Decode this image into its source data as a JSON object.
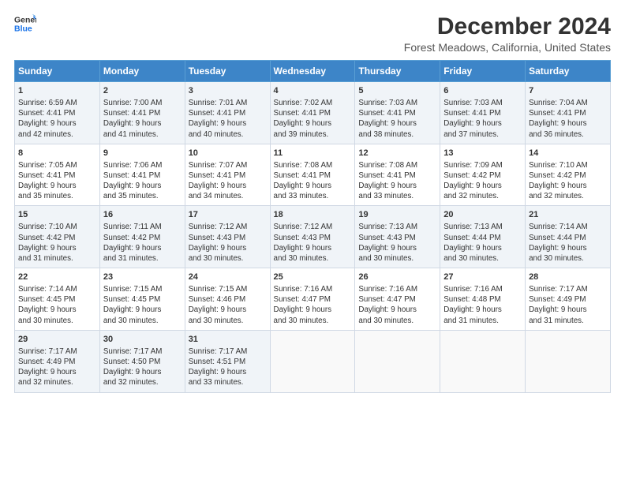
{
  "logo": {
    "line1": "General",
    "line2": "Blue"
  },
  "title": "December 2024",
  "subtitle": "Forest Meadows, California, United States",
  "days_header": [
    "Sunday",
    "Monday",
    "Tuesday",
    "Wednesday",
    "Thursday",
    "Friday",
    "Saturday"
  ],
  "weeks": [
    [
      {
        "num": "1",
        "info": "Sunrise: 6:59 AM\nSunset: 4:41 PM\nDaylight: 9 hours\nand 42 minutes."
      },
      {
        "num": "2",
        "info": "Sunrise: 7:00 AM\nSunset: 4:41 PM\nDaylight: 9 hours\nand 41 minutes."
      },
      {
        "num": "3",
        "info": "Sunrise: 7:01 AM\nSunset: 4:41 PM\nDaylight: 9 hours\nand 40 minutes."
      },
      {
        "num": "4",
        "info": "Sunrise: 7:02 AM\nSunset: 4:41 PM\nDaylight: 9 hours\nand 39 minutes."
      },
      {
        "num": "5",
        "info": "Sunrise: 7:03 AM\nSunset: 4:41 PM\nDaylight: 9 hours\nand 38 minutes."
      },
      {
        "num": "6",
        "info": "Sunrise: 7:03 AM\nSunset: 4:41 PM\nDaylight: 9 hours\nand 37 minutes."
      },
      {
        "num": "7",
        "info": "Sunrise: 7:04 AM\nSunset: 4:41 PM\nDaylight: 9 hours\nand 36 minutes."
      }
    ],
    [
      {
        "num": "8",
        "info": "Sunrise: 7:05 AM\nSunset: 4:41 PM\nDaylight: 9 hours\nand 35 minutes."
      },
      {
        "num": "9",
        "info": "Sunrise: 7:06 AM\nSunset: 4:41 PM\nDaylight: 9 hours\nand 35 minutes."
      },
      {
        "num": "10",
        "info": "Sunrise: 7:07 AM\nSunset: 4:41 PM\nDaylight: 9 hours\nand 34 minutes."
      },
      {
        "num": "11",
        "info": "Sunrise: 7:08 AM\nSunset: 4:41 PM\nDaylight: 9 hours\nand 33 minutes."
      },
      {
        "num": "12",
        "info": "Sunrise: 7:08 AM\nSunset: 4:41 PM\nDaylight: 9 hours\nand 33 minutes."
      },
      {
        "num": "13",
        "info": "Sunrise: 7:09 AM\nSunset: 4:42 PM\nDaylight: 9 hours\nand 32 minutes."
      },
      {
        "num": "14",
        "info": "Sunrise: 7:10 AM\nSunset: 4:42 PM\nDaylight: 9 hours\nand 32 minutes."
      }
    ],
    [
      {
        "num": "15",
        "info": "Sunrise: 7:10 AM\nSunset: 4:42 PM\nDaylight: 9 hours\nand 31 minutes."
      },
      {
        "num": "16",
        "info": "Sunrise: 7:11 AM\nSunset: 4:42 PM\nDaylight: 9 hours\nand 31 minutes."
      },
      {
        "num": "17",
        "info": "Sunrise: 7:12 AM\nSunset: 4:43 PM\nDaylight: 9 hours\nand 30 minutes."
      },
      {
        "num": "18",
        "info": "Sunrise: 7:12 AM\nSunset: 4:43 PM\nDaylight: 9 hours\nand 30 minutes."
      },
      {
        "num": "19",
        "info": "Sunrise: 7:13 AM\nSunset: 4:43 PM\nDaylight: 9 hours\nand 30 minutes."
      },
      {
        "num": "20",
        "info": "Sunrise: 7:13 AM\nSunset: 4:44 PM\nDaylight: 9 hours\nand 30 minutes."
      },
      {
        "num": "21",
        "info": "Sunrise: 7:14 AM\nSunset: 4:44 PM\nDaylight: 9 hours\nand 30 minutes."
      }
    ],
    [
      {
        "num": "22",
        "info": "Sunrise: 7:14 AM\nSunset: 4:45 PM\nDaylight: 9 hours\nand 30 minutes."
      },
      {
        "num": "23",
        "info": "Sunrise: 7:15 AM\nSunset: 4:45 PM\nDaylight: 9 hours\nand 30 minutes."
      },
      {
        "num": "24",
        "info": "Sunrise: 7:15 AM\nSunset: 4:46 PM\nDaylight: 9 hours\nand 30 minutes."
      },
      {
        "num": "25",
        "info": "Sunrise: 7:16 AM\nSunset: 4:47 PM\nDaylight: 9 hours\nand 30 minutes."
      },
      {
        "num": "26",
        "info": "Sunrise: 7:16 AM\nSunset: 4:47 PM\nDaylight: 9 hours\nand 30 minutes."
      },
      {
        "num": "27",
        "info": "Sunrise: 7:16 AM\nSunset: 4:48 PM\nDaylight: 9 hours\nand 31 minutes."
      },
      {
        "num": "28",
        "info": "Sunrise: 7:17 AM\nSunset: 4:49 PM\nDaylight: 9 hours\nand 31 minutes."
      }
    ],
    [
      {
        "num": "29",
        "info": "Sunrise: 7:17 AM\nSunset: 4:49 PM\nDaylight: 9 hours\nand 32 minutes."
      },
      {
        "num": "30",
        "info": "Sunrise: 7:17 AM\nSunset: 4:50 PM\nDaylight: 9 hours\nand 32 minutes."
      },
      {
        "num": "31",
        "info": "Sunrise: 7:17 AM\nSunset: 4:51 PM\nDaylight: 9 hours\nand 33 minutes."
      },
      {
        "num": "",
        "info": ""
      },
      {
        "num": "",
        "info": ""
      },
      {
        "num": "",
        "info": ""
      },
      {
        "num": "",
        "info": ""
      }
    ]
  ]
}
